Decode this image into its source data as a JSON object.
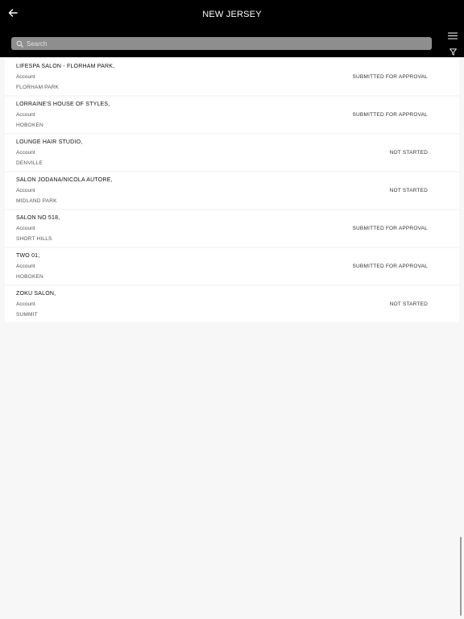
{
  "header": {
    "title": "NEW JERSEY",
    "back_icon": "arrow-left-icon",
    "menu_icon": "hamburger-menu-icon",
    "filter_icon": "filter-funnel-icon"
  },
  "search": {
    "placeholder": "Search",
    "value": ""
  },
  "accounts": [
    {
      "name": "LIFESPA SALON - FLORHAM PARK,",
      "type": "Account",
      "city": "FLORHAM PARK",
      "status": "SUBMITTED FOR APPROVAL"
    },
    {
      "name": "LORRAINE'S HOUSE OF STYLES,",
      "type": "Account",
      "city": "HOBOKEN",
      "status": "SUBMITTED FOR APPROVAL"
    },
    {
      "name": "LOUNGE HAIR STUDIO,",
      "type": "Account",
      "city": "DENVILLE",
      "status": "NOT STARTED"
    },
    {
      "name": "SALON JODANA/NICOLA AUTORE,",
      "type": "Account",
      "city": "MIDLAND PARK",
      "status": "NOT STARTED"
    },
    {
      "name": "SALON NO 518,",
      "type": "Account",
      "city": "SHORT HILLS",
      "status": "SUBMITTED FOR APPROVAL"
    },
    {
      "name": "TWO 01,",
      "type": "Account",
      "city": "HOBOKEN",
      "status": "SUBMITTED FOR APPROVAL"
    },
    {
      "name": "ZOKU SALON,",
      "type": "Account",
      "city": "SUMMIT",
      "status": "NOT STARTED"
    }
  ],
  "colors": {
    "header_bg": "#000000",
    "search_bg": "#8e8e8e",
    "page_bg": "#f7f7f7",
    "row_bg": "#ffffff"
  }
}
